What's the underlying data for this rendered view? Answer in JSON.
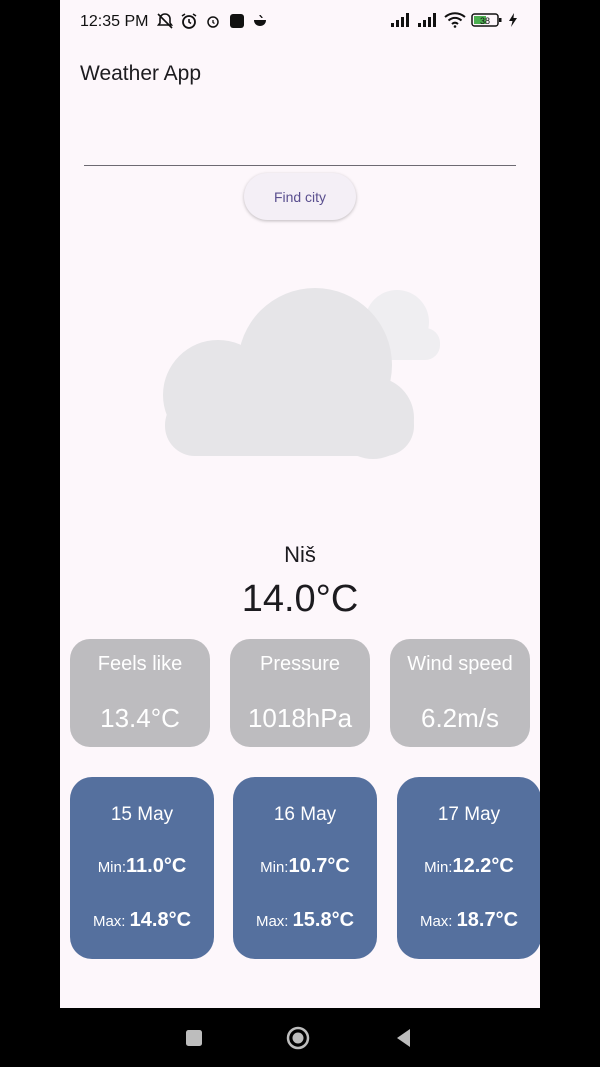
{
  "status_bar": {
    "time": "12:35 PM",
    "left_icons": [
      "muted-bell-icon",
      "alarm-icon",
      "alarm-small-icon",
      "square-app-icon",
      "coffee-icon"
    ],
    "right_icons": [
      "signal-icon",
      "signal-icon",
      "wifi-icon",
      "battery-icon",
      "charging-icon"
    ],
    "battery_level": "38"
  },
  "app": {
    "title": "Weather App"
  },
  "search": {
    "value": "",
    "placeholder": "",
    "button_label": "Find city"
  },
  "current": {
    "city": "Niš",
    "temperature": "14.0°C",
    "icon": "cloud-icon"
  },
  "stats": [
    {
      "label": "Feels like",
      "value": "13.4°C"
    },
    {
      "label": "Pressure",
      "value": "1018hPa"
    },
    {
      "label": "Wind speed",
      "value": "6.2m/s"
    }
  ],
  "forecast": [
    {
      "date": "15 May",
      "min_label": "Min:",
      "min": "11.0°C",
      "max_label": "Max: ",
      "max": "14.8°C"
    },
    {
      "date": "16 May",
      "min_label": "Min:",
      "min": "10.7°C",
      "max_label": "Max: ",
      "max": "15.8°C"
    },
    {
      "date": "17 May",
      "min_label": "Min:",
      "min": "12.2°C",
      "max_label": "Max: ",
      "max": "18.7°C"
    }
  ],
  "colors": {
    "background": "#fdf7fb",
    "stat_card": "#bdbcbf",
    "forecast_card": "#55709e",
    "button_text": "#5a4f8f"
  },
  "nav": {
    "buttons": [
      "recent-apps-icon",
      "home-icon",
      "back-icon"
    ]
  }
}
